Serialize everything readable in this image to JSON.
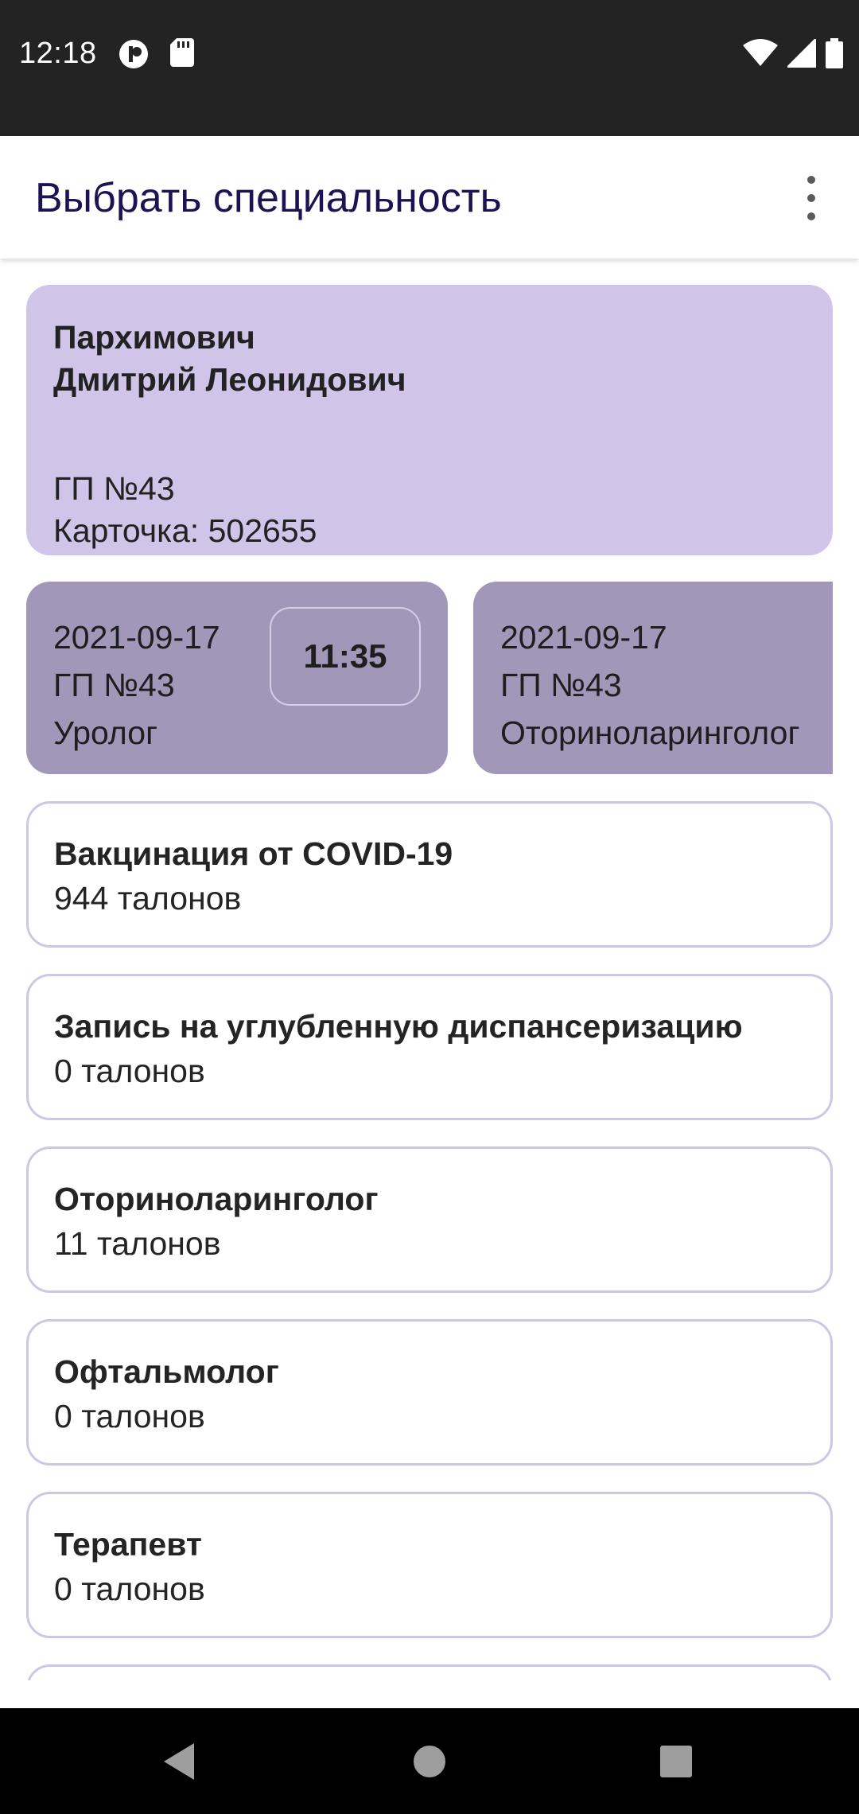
{
  "status_bar": {
    "time": "12:18",
    "icons": [
      "assistant-icon",
      "sd-card-icon",
      "wifi-icon",
      "cell-signal-icon",
      "battery-icon"
    ]
  },
  "app_bar": {
    "title": "Выбрать специальность",
    "menu_icon": "more-vert-icon"
  },
  "profile": {
    "name": "Пархимович\nДмитрий Леонидович",
    "clinic": "ГП №43",
    "card": "Карточка: 502655"
  },
  "appointments": [
    {
      "date": "2021-09-17",
      "clinic": "ГП №43",
      "specialty": "Уролог",
      "time": "11:35"
    },
    {
      "date": "2021-09-17",
      "clinic": "ГП №43",
      "specialty": "Оториноларинголог"
    }
  ],
  "specialties": [
    {
      "name": "Вакцинация от COVID-19",
      "count": "944 талонов"
    },
    {
      "name": "Запись на углубленную диспансеризацию",
      "count": "0 талонов"
    },
    {
      "name": "Оториноларинголог",
      "count": "11 талонов"
    },
    {
      "name": "Офтальмолог",
      "count": "0 талонов"
    },
    {
      "name": "Терапевт",
      "count": "0 талонов"
    }
  ],
  "nav_bar": {
    "icons": [
      "back-icon",
      "home-icon",
      "recents-icon"
    ]
  },
  "colors": {
    "title": "#1c1352",
    "profile_card": "#d1c4e9",
    "appointment_card": "#a197b9",
    "card_border": "#cfc6e6"
  }
}
